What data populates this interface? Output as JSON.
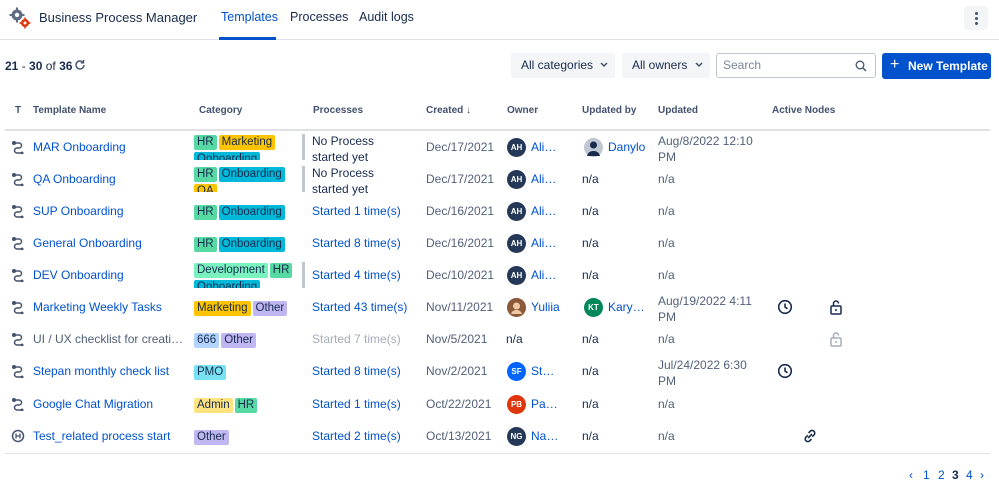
{
  "header": {
    "app_title": "Business Process Manager",
    "tabs": [
      {
        "label": "Templates",
        "active": true
      },
      {
        "label": "Processes",
        "active": false
      },
      {
        "label": "Audit logs",
        "active": false
      }
    ]
  },
  "toolbar": {
    "range_start": "21",
    "range_sep": " - ",
    "range_end": "30",
    "range_of": " of ",
    "range_total": "36",
    "categories_label": "All categories",
    "owners_label": "All owners",
    "search_placeholder": "Search",
    "search_value": "",
    "new_button_label": "New Template"
  },
  "columns": {
    "type": "T",
    "name": "Template Name",
    "category": "Category",
    "processes": "Processes",
    "created": "Created",
    "owner": "Owner",
    "updated_by": "Updated by",
    "updated": "Updated",
    "active_nodes": "Active Nodes"
  },
  "colors": {
    "accent": "#0052cc",
    "tag_hr": "#57d9a3",
    "tag_marketing": "#ffc400",
    "tag_onboarding": "#00b8d9",
    "tag_qa": "#ffc400",
    "tag_development": "#79f2c0",
    "tag_other": "#c0b6f2",
    "tag_666": "#b3d4ff",
    "tag_pmo": "#79e2f2",
    "tag_admin": "#ffe380"
  },
  "rows": [
    {
      "name": "MAR Onboarding",
      "categories": [
        "HR",
        "Marketing",
        "Onboarding"
      ],
      "processes": "No Process started yet",
      "created": "Dec/17/2021",
      "owner_initials": "AH",
      "owner": "Alina Hnatiuk",
      "updated_by": "Danylo",
      "updated": "Aug/8/2022 12:10 PM"
    },
    {
      "name": "QA Onboarding",
      "categories": [
        "HR",
        "Onboarding",
        "QA"
      ],
      "processes": "No Process started yet",
      "created": "Dec/17/2021",
      "owner_initials": "AH",
      "owner": "Alina Hnatiuk",
      "updated_by": "n/a",
      "updated": "n/a"
    },
    {
      "name": "SUP Onboarding",
      "categories": [
        "HR",
        "Onboarding"
      ],
      "processes": "Started 1 time(s)",
      "created": "Dec/16/2021",
      "owner_initials": "AH",
      "owner": "Alina Hnatiuk",
      "updated_by": "n/a",
      "updated": "n/a"
    },
    {
      "name": "General Onboarding",
      "categories": [
        "HR",
        "Onboarding"
      ],
      "processes": "Started 8 time(s)",
      "created": "Dec/16/2021",
      "owner_initials": "AH",
      "owner": "Alina Hnatiuk",
      "updated_by": "n/a",
      "updated": "n/a"
    },
    {
      "name": "DEV Onboarding",
      "categories": [
        "Development",
        "HR",
        "Onboarding"
      ],
      "processes": "Started 4 time(s)",
      "created": "Dec/10/2021",
      "owner_initials": "AH",
      "owner": "Alina Hnatiuk",
      "updated_by": "n/a",
      "updated": "n/a"
    },
    {
      "name": "Marketing Weekly Tasks",
      "categories": [
        "Marketing",
        "Other"
      ],
      "processes": "Started 43 time(s)",
      "created": "Nov/11/2021",
      "owner_initials": "",
      "owner": "Yuliia",
      "updated_by_initials": "KT",
      "updated_by": "Karyna",
      "updated": "Aug/19/2022 4:11 PM"
    },
    {
      "name": "UI / UX checklist for creating new features",
      "categories": [
        "666",
        "Other"
      ],
      "processes": "Started 7 time(s)",
      "created": "Nov/5/2021",
      "owner_initials": "",
      "owner": "n/a",
      "updated_by": "n/a",
      "updated": "n/a"
    },
    {
      "name": "Stepan monthly check list",
      "categories": [
        "PMO"
      ],
      "processes": "Started 8 time(s)",
      "created": "Nov/2/2021",
      "owner_initials": "SF",
      "owner": "Stepan",
      "updated_by": "n/a",
      "updated": "Jul/24/2022 6:30 PM"
    },
    {
      "name": "Google Chat Migration",
      "categories": [
        "Admin",
        "HR"
      ],
      "processes": "Started 1 time(s)",
      "created": "Oct/22/2021",
      "owner_initials": "PB",
      "owner": "Pavlo",
      "updated_by": "n/a",
      "updated": "n/a"
    },
    {
      "name": "Test_related process start",
      "categories": [
        "Other"
      ],
      "processes": "Started 2 time(s)",
      "created": "Oct/13/2021",
      "owner_initials": "NG",
      "owner": "Natalia",
      "updated_by": "n/a",
      "updated": "n/a"
    }
  ],
  "pagination": {
    "prev": "‹",
    "pages": [
      "1",
      "2",
      "3",
      "4"
    ],
    "current": "3",
    "next": "›"
  }
}
